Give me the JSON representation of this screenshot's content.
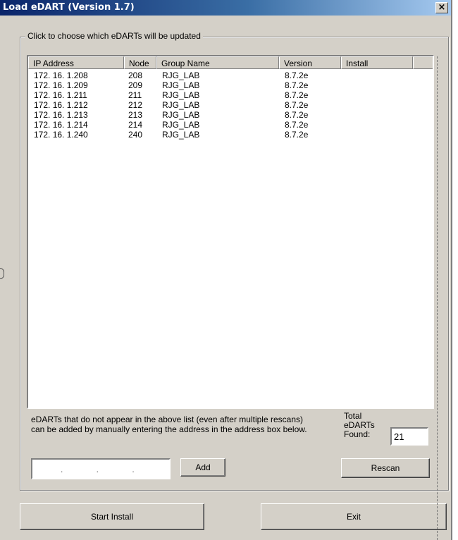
{
  "window": {
    "title": "Load eDART (Version 1.7)",
    "close_glyph": "×"
  },
  "group": {
    "legend": "Click to choose which eDARTs will be updated"
  },
  "list": {
    "columns": [
      "IP Address",
      "Node",
      "Group Name",
      "Version",
      "Install",
      ""
    ],
    "rows": [
      {
        "ip": "172. 16. 1.208",
        "node": "208",
        "group": "RJG_LAB",
        "version": "8.7.2e",
        "install": ""
      },
      {
        "ip": "172. 16. 1.209",
        "node": "209",
        "group": "RJG_LAB",
        "version": "8.7.2e",
        "install": ""
      },
      {
        "ip": "172. 16. 1.211",
        "node": "211",
        "group": "RJG_LAB",
        "version": "8.7.2e",
        "install": ""
      },
      {
        "ip": "172. 16. 1.212",
        "node": "212",
        "group": "RJG_LAB",
        "version": "8.7.2e",
        "install": ""
      },
      {
        "ip": "172. 16. 1.213",
        "node": "213",
        "group": "RJG_LAB",
        "version": "8.7.2e",
        "install": ""
      },
      {
        "ip": "172. 16. 1.214",
        "node": "214",
        "group": "RJG_LAB",
        "version": "8.7.2e",
        "install": ""
      },
      {
        "ip": "172. 16. 1.240",
        "node": "240",
        "group": "RJG_LAB",
        "version": "8.7.2e",
        "install": ""
      }
    ]
  },
  "note": "eDARTs that do not appear in the above list (even after multiple rescans) can be added by manually entering the address in the address box below.",
  "total": {
    "label": "Total eDARTs Found:",
    "value": "21"
  },
  "ip_input": {
    "value": ". . ."
  },
  "buttons": {
    "add": "Add",
    "rescan": "Rescan",
    "start_install": "Start Install",
    "exit": "Exit"
  }
}
